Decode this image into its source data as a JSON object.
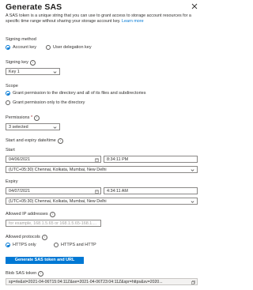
{
  "header": {
    "title": "Generate SAS"
  },
  "description": {
    "text": "A SAS token is a unique string that you can use to grant access to storage account resources for a specific time range without sharing your storage account key.",
    "link": "Learn more"
  },
  "signing_method": {
    "label": "Signing method",
    "options": [
      "Account key",
      "User delegation key"
    ],
    "selected": "Account key"
  },
  "signing_key": {
    "label": "Signing key",
    "value": "Key 1"
  },
  "scope": {
    "label": "Scope",
    "options": [
      "Grant permission to the directory and all of its files and subdirectories",
      "Grant permission only to the directory"
    ],
    "selected": "Grant permission to the directory and all of its files and subdirectories"
  },
  "permissions": {
    "label": "Permissions",
    "value": "3 selected"
  },
  "dates": {
    "label": "Start and expiry date/time",
    "start_label": "Start",
    "start_date": "04/06/2021",
    "start_time": "8:34:11 PM",
    "start_tz": "(UTC+05:30) Chennai, Kolkata, Mumbai, New Delhi",
    "expiry_label": "Expiry",
    "expiry_date": "04/07/2021",
    "expiry_time": "4:34:11 AM",
    "expiry_tz": "(UTC+05:30) Chennai, Kolkata, Mumbai, New Delhi"
  },
  "allowed_ip": {
    "label": "Allowed IP addresses",
    "placeholder": "for example, 168.1.5.65 or 168.1.5.65-168.1...."
  },
  "protocols": {
    "label": "Allowed protocols",
    "options": [
      "HTTPS only",
      "HTTPS and HTTP"
    ],
    "selected": "HTTPS only"
  },
  "generate_button": "Generate SAS token and URL",
  "token": {
    "label": "Blob SAS token",
    "value": "sp=rle&st=2021-04-06T15:04:11Z&se=2021-04-06T23:04:11Z&spr=https&sv=2020..."
  },
  "colors": {
    "accent": "#0078d4",
    "required": "#a4262c"
  }
}
